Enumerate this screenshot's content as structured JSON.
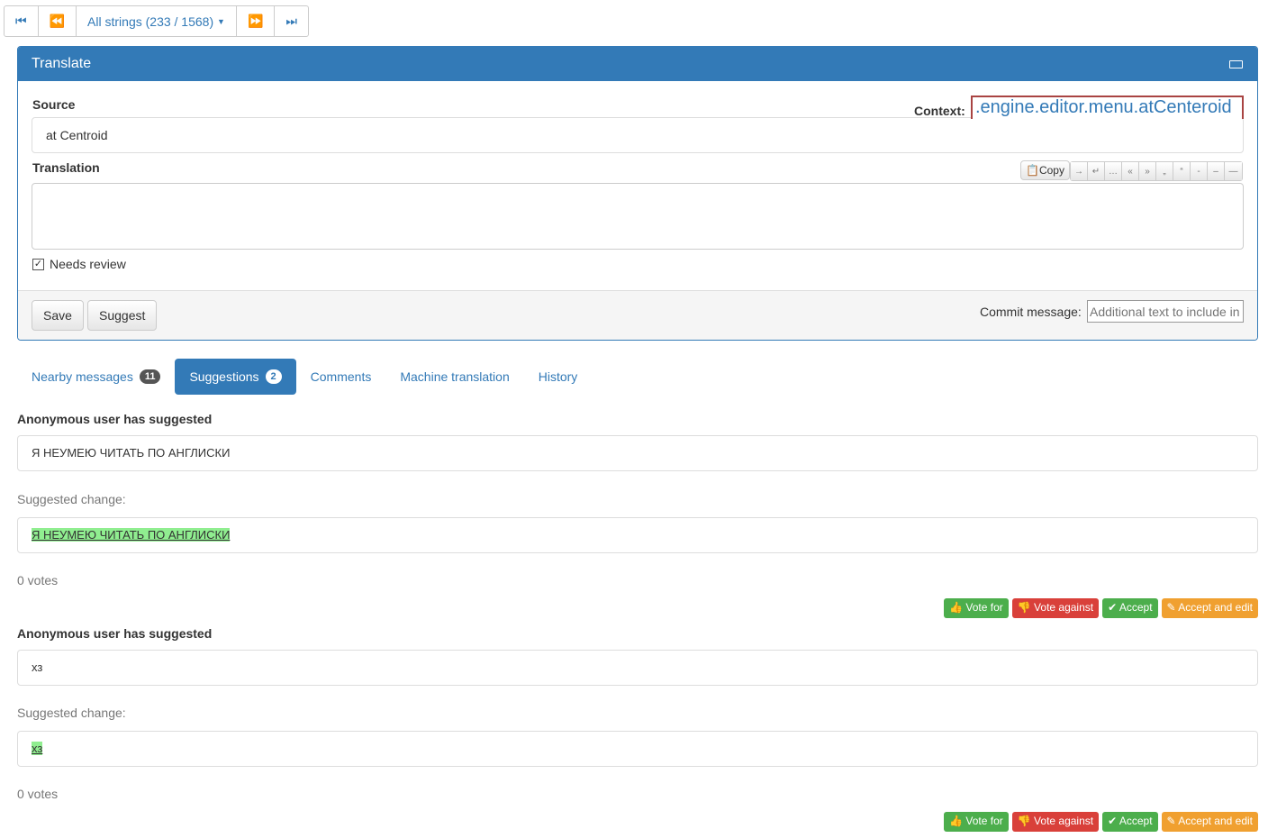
{
  "nav": {
    "first": "⏮",
    "prev": "⏪",
    "filter": "All strings (233 / 1568)",
    "next": "⏩",
    "last": "⏭"
  },
  "panel": {
    "title": "Translate",
    "source_label": "Source",
    "context_label": "Context:",
    "context": ".engine.editor.menu.atCenteroid",
    "source": "at Centroid",
    "translation_label": "Translation",
    "translation": "",
    "copy": "Copy",
    "special_chars": [
      "→",
      "↵",
      "…",
      "«",
      "»",
      "„",
      "“",
      "-",
      "–",
      "—"
    ],
    "needs_review": "Needs review",
    "save": "Save",
    "suggest": "Suggest",
    "commit_label": "Commit message:",
    "commit_placeholder": "Additional text to include in"
  },
  "tabs": [
    {
      "label": "Nearby messages",
      "badge": "11"
    },
    {
      "label": "Suggestions",
      "badge": "2"
    },
    {
      "label": "Comments"
    },
    {
      "label": "Machine translation"
    },
    {
      "label": "History"
    }
  ],
  "suggestions": [
    {
      "author": "Anonymous user has suggested",
      "text": "Я НЕУМЕЮ ЧИТАТЬ ПО АНГЛИСКИ",
      "change_label": "Suggested change:",
      "change": "Я НЕУМЕЮ ЧИТАТЬ ПО АНГЛИСКИ",
      "votes": "0 votes"
    },
    {
      "author": "Anonymous user has suggested",
      "text": "хз",
      "change_label": "Suggested change:",
      "change": "хз",
      "votes": "0 votes"
    }
  ],
  "actions": {
    "vote_for": "Vote for",
    "vote_against": "Vote against",
    "accept": "Accept",
    "accept_edit": "Accept and edit"
  },
  "colors": {
    "primary": "#337ab7",
    "success": "#4cae4c",
    "danger": "#d9403a",
    "warning": "#f0a030"
  }
}
